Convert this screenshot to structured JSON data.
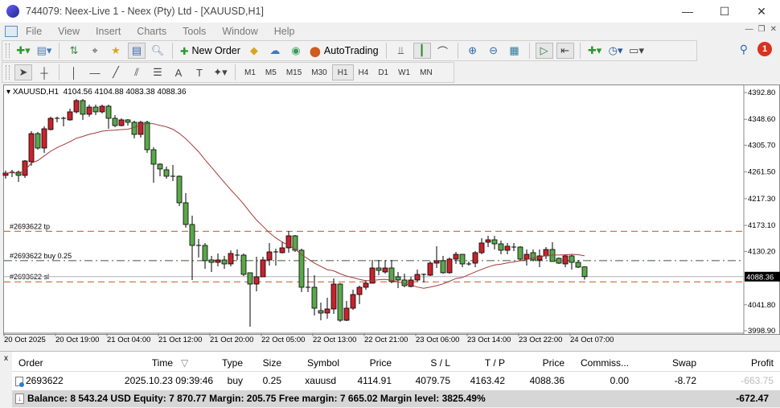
{
  "window": {
    "title": "744079: Neex-Live 1 - Neex (Pty) Ltd - [XAUUSD,H1]",
    "minimize": "—",
    "maximize": "☐",
    "close": "✕"
  },
  "menu": [
    "File",
    "View",
    "Insert",
    "Charts",
    "Tools",
    "Window",
    "Help"
  ],
  "toolbar": {
    "new_order": "New Order",
    "autotrading": "AutoTrading"
  },
  "notifications": {
    "count": "1"
  },
  "timeframes": [
    "M1",
    "M5",
    "M15",
    "M30",
    "H1",
    "H4",
    "D1",
    "W1",
    "MN"
  ],
  "active_timeframe": "H1",
  "chart_header": {
    "symbol": "XAUUSD,H1",
    "ohlc": "4104.56 4104.88 4083.38 4088.36"
  },
  "order_lines": {
    "tp": {
      "label": "#2693622 tp",
      "price": 4163.42
    },
    "entry": {
      "label": "#2693622 buy 0.25",
      "price": 4114.91
    },
    "sl": {
      "label": "#2693622 sl",
      "price": 4079.75
    }
  },
  "colors": {
    "bull": "#c8232c",
    "bear": "#5aa84a",
    "ma": "#a33a3a",
    "tp_sl": "#c0572a",
    "entry": "#3a5a3a",
    "bid": "#b0b0b0"
  },
  "chart_data": {
    "type": "candlestick",
    "symbol": "XAUUSD",
    "timeframe": "H1",
    "ylim": [
      3998.9,
      4392.8
    ],
    "y_ticks": [
      "4392.80",
      "4348.60",
      "4305.70",
      "4261.50",
      "4217.30",
      "4173.10",
      "4130.20",
      "4041.80",
      "3998.90"
    ],
    "current_price": "4088.36",
    "x_labels": [
      "20 Oct 2025",
      "20 Oct 19:00",
      "21 Oct 04:00",
      "21 Oct 12:00",
      "21 Oct 20:00",
      "22 Oct 05:00",
      "22 Oct 13:00",
      "22 Oct 21:00",
      "23 Oct 06:00",
      "23 Oct 14:00",
      "23 Oct 22:00",
      "24 Oct 07:00"
    ],
    "ohlc": [
      [
        4255.8,
        4263.7,
        4250.4,
        4259.7
      ],
      [
        4261.1,
        4265.1,
        4253.1,
        4261.1
      ],
      [
        4261.1,
        4263.7,
        4245.1,
        4255.8
      ],
      [
        4255.8,
        4281.0,
        4251.8,
        4279.7
      ],
      [
        4278.4,
        4328.9,
        4271.7,
        4324.9
      ],
      [
        4324.9,
        4327.6,
        4298.3,
        4301.0
      ],
      [
        4301.0,
        4336.9,
        4293.0,
        4332.9
      ],
      [
        4331.6,
        4352.9,
        4330.3,
        4350.2
      ],
      [
        4350.2,
        4352.9,
        4343.6,
        4350.2
      ],
      [
        4350.2,
        4352.9,
        4336.9,
        4350.2
      ],
      [
        4347.6,
        4366.2,
        4346.2,
        4360.9
      ],
      [
        4360.9,
        4382.2,
        4358.2,
        4379.5
      ],
      [
        4379.5,
        4382.2,
        4347.6,
        4356.9
      ],
      [
        4356.9,
        4372.8,
        4352.9,
        4368.8
      ],
      [
        4368.8,
        4372.8,
        4355.5,
        4360.9
      ],
      [
        4360.9,
        4372.8,
        4358.2,
        4370.2
      ],
      [
        4370.2,
        4372.8,
        4332.9,
        4350.2
      ],
      [
        4350.2,
        4355.5,
        4335.6,
        4338.2
      ],
      [
        4338.2,
        4350.2,
        4336.9,
        4347.6
      ],
      [
        4347.6,
        4348.9,
        4338.2,
        4343.6
      ],
      [
        4343.6,
        4346.2,
        4317.0,
        4323.6
      ],
      [
        4323.6,
        4346.2,
        4318.3,
        4343.6
      ],
      [
        4343.6,
        4346.2,
        4293.0,
        4298.3
      ],
      [
        4298.3,
        4302.3,
        4243.8,
        4274.4
      ],
      [
        4274.4,
        4275.7,
        4254.4,
        4266.4
      ],
      [
        4265.1,
        4270.4,
        4250.4,
        4254.4
      ],
      [
        4254.4,
        4273.0,
        4246.4,
        4254.4
      ],
      [
        4254.4,
        4255.8,
        4205.2,
        4210.5
      ],
      [
        4210.5,
        4226.5,
        4169.3,
        4174.6
      ],
      [
        4174.6,
        4189.2,
        4082.8,
        4140.0
      ],
      [
        4140.0,
        4150.6,
        4120.0,
        4140.0
      ],
      [
        4140.0,
        4144.0,
        4101.4,
        4114.7
      ],
      [
        4116.0,
        4122.7,
        4096.1,
        4112.0
      ],
      [
        4112.0,
        4126.7,
        4105.4,
        4116.0
      ],
      [
        4116.0,
        4122.7,
        4101.4,
        4109.4
      ],
      [
        4109.4,
        4132.0,
        4105.4,
        4126.7
      ],
      [
        4124.0,
        4133.3,
        4116.0,
        4124.0
      ],
      [
        4124.0,
        4126.7,
        4089.4,
        4092.1
      ],
      [
        4094.8,
        4094.8,
        4005.6,
        4076.1
      ],
      [
        4076.1,
        4121.4,
        4064.1,
        4088.1
      ],
      [
        4088.1,
        4121.4,
        4088.1,
        4116.0
      ],
      [
        4116.0,
        4144.0,
        4106.7,
        4129.3
      ],
      [
        4129.3,
        4134.7,
        4106.7,
        4129.3
      ],
      [
        4128.0,
        4146.6,
        4126.7,
        4136.0
      ],
      [
        4136.0,
        4163.9,
        4128.0,
        4155.9
      ],
      [
        4155.9,
        4157.3,
        4129.3,
        4132.0
      ],
      [
        4132.0,
        4134.7,
        4062.8,
        4070.8
      ],
      [
        4070.8,
        4102.7,
        4062.8,
        4070.8
      ],
      [
        4070.8,
        4090.8,
        4024.2,
        4036.2
      ],
      [
        4032.2,
        4045.5,
        4016.2,
        4028.2
      ],
      [
        4028.2,
        4053.5,
        4018.9,
        4034.9
      ],
      [
        4034.9,
        4085.4,
        4026.9,
        4076.1
      ],
      [
        4076.1,
        4077.5,
        4013.6,
        4016.2
      ],
      [
        4016.2,
        4048.2,
        4014.9,
        4036.2
      ],
      [
        4036.2,
        4066.8,
        4033.5,
        4058.8
      ],
      [
        4058.8,
        4073.5,
        4042.9,
        4070.8
      ],
      [
        4070.8,
        4082.8,
        4066.8,
        4077.5
      ],
      [
        4077.5,
        4116.0,
        4077.5,
        4102.7
      ],
      [
        4102.7,
        4116.0,
        4090.8,
        4098.7
      ],
      [
        4096.1,
        4116.0,
        4093.4,
        4102.7
      ],
      [
        4102.7,
        4116.0,
        4077.5,
        4080.1
      ],
      [
        4088.1,
        4096.1,
        4069.5,
        4082.8
      ],
      [
        4082.8,
        4093.4,
        4070.8,
        4073.5
      ],
      [
        4072.1,
        4088.1,
        4070.8,
        4082.8
      ],
      [
        4082.8,
        4100.1,
        4080.1,
        4092.1
      ],
      [
        4092.1,
        4093.4,
        4078.8,
        4092.1
      ],
      [
        4090.8,
        4113.4,
        4089.4,
        4110.7
      ],
      [
        4110.7,
        4138.7,
        4102.7,
        4114.7
      ],
      [
        4114.7,
        4122.7,
        4093.4,
        4094.8
      ],
      [
        4094.8,
        4120.0,
        4093.4,
        4117.4
      ],
      [
        4117.4,
        4129.3,
        4109.4,
        4125.3
      ],
      [
        4125.3,
        4125.3,
        4104.1,
        4109.4
      ],
      [
        4109.4,
        4113.4,
        4106.7,
        4109.4
      ],
      [
        4110.7,
        4130.7,
        4104.1,
        4128.0
      ],
      [
        4128.0,
        4151.9,
        4125.3,
        4144.0
      ],
      [
        4145.3,
        4155.9,
        4137.3,
        4149.3
      ],
      [
        4149.3,
        4155.9,
        4133.3,
        4142.6
      ],
      [
        4142.6,
        4148.0,
        4125.3,
        4132.0
      ],
      [
        4132.0,
        4144.0,
        4125.3,
        4138.7
      ],
      [
        4137.3,
        4144.0,
        4130.7,
        4137.3
      ],
      [
        4137.3,
        4138.7,
        4114.7,
        4117.4
      ],
      [
        4117.4,
        4133.3,
        4106.7,
        4125.3
      ],
      [
        4128.0,
        4133.3,
        4113.4,
        4116.0
      ],
      [
        4116.0,
        4133.3,
        4104.1,
        4122.7
      ],
      [
        4122.7,
        4137.3,
        4117.4,
        4133.3
      ],
      [
        4133.3,
        4145.3,
        4113.4,
        4113.4
      ],
      [
        4118.7,
        4120.0,
        4109.4,
        4110.7
      ],
      [
        4109.4,
        4125.3,
        4104.1,
        4122.7
      ],
      [
        4122.7,
        4125.3,
        4100.1,
        4112.0
      ],
      [
        4112.0,
        4116.0,
        4102.7,
        4104.1
      ],
      [
        4104.56,
        4104.88,
        4083.38,
        4088.36
      ]
    ],
    "ma_period": 20
  },
  "terminal": {
    "close": "x",
    "columns": [
      "Order",
      "Time",
      "Type",
      "Size",
      "Symbol",
      "Price",
      "S / L",
      "T / P",
      "Price",
      "Commiss...",
      "Swap",
      "Profit"
    ],
    "sort_icon": "▽",
    "orders": [
      {
        "order": "2693622",
        "time": "2025.10.23 09:39:46",
        "type": "buy",
        "size": "0.25",
        "symbol": "xauusd",
        "price": "4114.91",
        "sl": "4079.75",
        "tp": "4163.42",
        "current": "4088.36",
        "commission": "0.00",
        "swap": "-8.72",
        "profit": "-663.75"
      }
    ],
    "summary": {
      "text": "Balance: 8 543.24 USD  Equity: 7 870.77  Margin: 205.75  Free margin: 7 665.02  Margin level: 3825.49%",
      "profit": "-672.47"
    }
  }
}
